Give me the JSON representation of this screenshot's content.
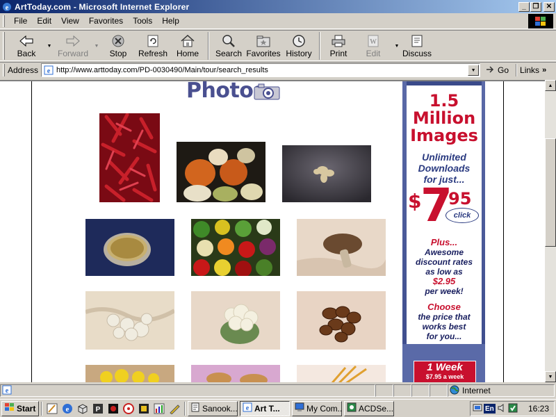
{
  "window": {
    "title": "ArtToday.com - Microsoft Internet Explorer"
  },
  "menu": {
    "file": "File",
    "edit": "Edit",
    "view": "View",
    "favorites": "Favorites",
    "tools": "Tools",
    "help": "Help"
  },
  "toolbar": {
    "back": "Back",
    "forward": "Forward",
    "stop": "Stop",
    "refresh": "Refresh",
    "home": "Home",
    "search": "Search",
    "favorites": "Favorites",
    "history": "History",
    "print": "Print",
    "edit": "Edit",
    "discuss": "Discuss"
  },
  "address": {
    "label": "Address",
    "url": "http://www.arttoday.com/PD-0030490/Main/tour/search_results",
    "go": "Go",
    "links": "Links"
  },
  "page": {
    "heading": "Photos"
  },
  "ad": {
    "line1": "1.5",
    "line2": "Million",
    "line3": "Images",
    "tag1": "Unlimited",
    "tag2": "Downloads",
    "tag3": "for just...",
    "price_dollar": "$",
    "price_main": "7",
    "price_cents": "95",
    "click": "click",
    "plus1": "Plus...",
    "plus2": "Awesome",
    "plus3": "discount rates",
    "plus4": "as low as",
    "plus_price": "$2.95",
    "plus5": "per week!",
    "choose1": "Choose",
    "choose2": "the price that",
    "choose3": "works best",
    "choose4": "for you...",
    "week_title": "1 Week",
    "week_price": "$7.95 a week"
  },
  "status": {
    "zone": "Internet"
  },
  "taskbar": {
    "start": "Start",
    "tasks": [
      "Sanook...",
      "Art T...",
      "My Com...",
      "ACDSe..."
    ],
    "lang": "En",
    "clock": "16:23"
  }
}
